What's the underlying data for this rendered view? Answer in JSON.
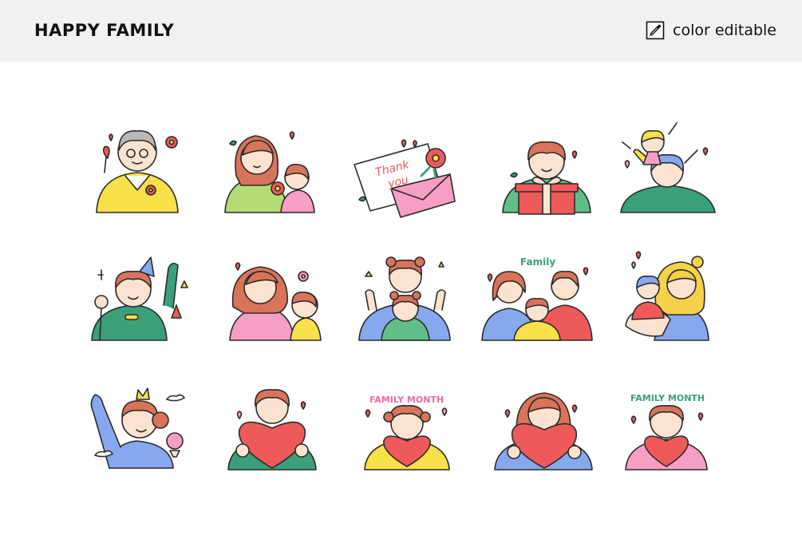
{
  "header": {
    "title": "HAPPY FAMILY",
    "badge_icon": "eyedropper-icon",
    "badge_label": "color editable"
  },
  "palette": {
    "outline": "#2b2b2b",
    "skin": "#fbe3cf",
    "hair_auburn": "#d9745a",
    "hair_gray": "#b9b9b9",
    "hair_blonde": "#f6d24a",
    "cheek": "#f59a9a",
    "red": "#ee5a5a",
    "pink": "#f79ec4",
    "yellow": "#f8e048",
    "green": "#5fbf86",
    "lime": "#b4dc76",
    "blue": "#86a8ee",
    "teal": "#3aa07a"
  },
  "tiles": [
    {
      "id": "grandpa-flowers",
      "row": 1
    },
    {
      "id": "mother-child-flower",
      "row": 1
    },
    {
      "id": "thank-you-letter",
      "row": 1,
      "text": "Thank you"
    },
    {
      "id": "boy-gift-box",
      "row": 1
    },
    {
      "id": "girl-on-shoulders",
      "row": 1
    },
    {
      "id": "boy-party-hat",
      "row": 2
    },
    {
      "id": "mother-hugging-child",
      "row": 2
    },
    {
      "id": "parent-with-bear-ears-child",
      "row": 2
    },
    {
      "id": "family-of-three",
      "row": 2,
      "text": "Family"
    },
    {
      "id": "blonde-mother-baby",
      "row": 2
    },
    {
      "id": "girl-princess-crown",
      "row": 3
    },
    {
      "id": "woman-heart",
      "row": 3
    },
    {
      "id": "girl-heart-family-month",
      "row": 3,
      "text": "FAMILY MONTH"
    },
    {
      "id": "mother-heart",
      "row": 3
    },
    {
      "id": "boy-heart-family-month",
      "row": 3,
      "text": "FAMILY MONTH"
    }
  ]
}
